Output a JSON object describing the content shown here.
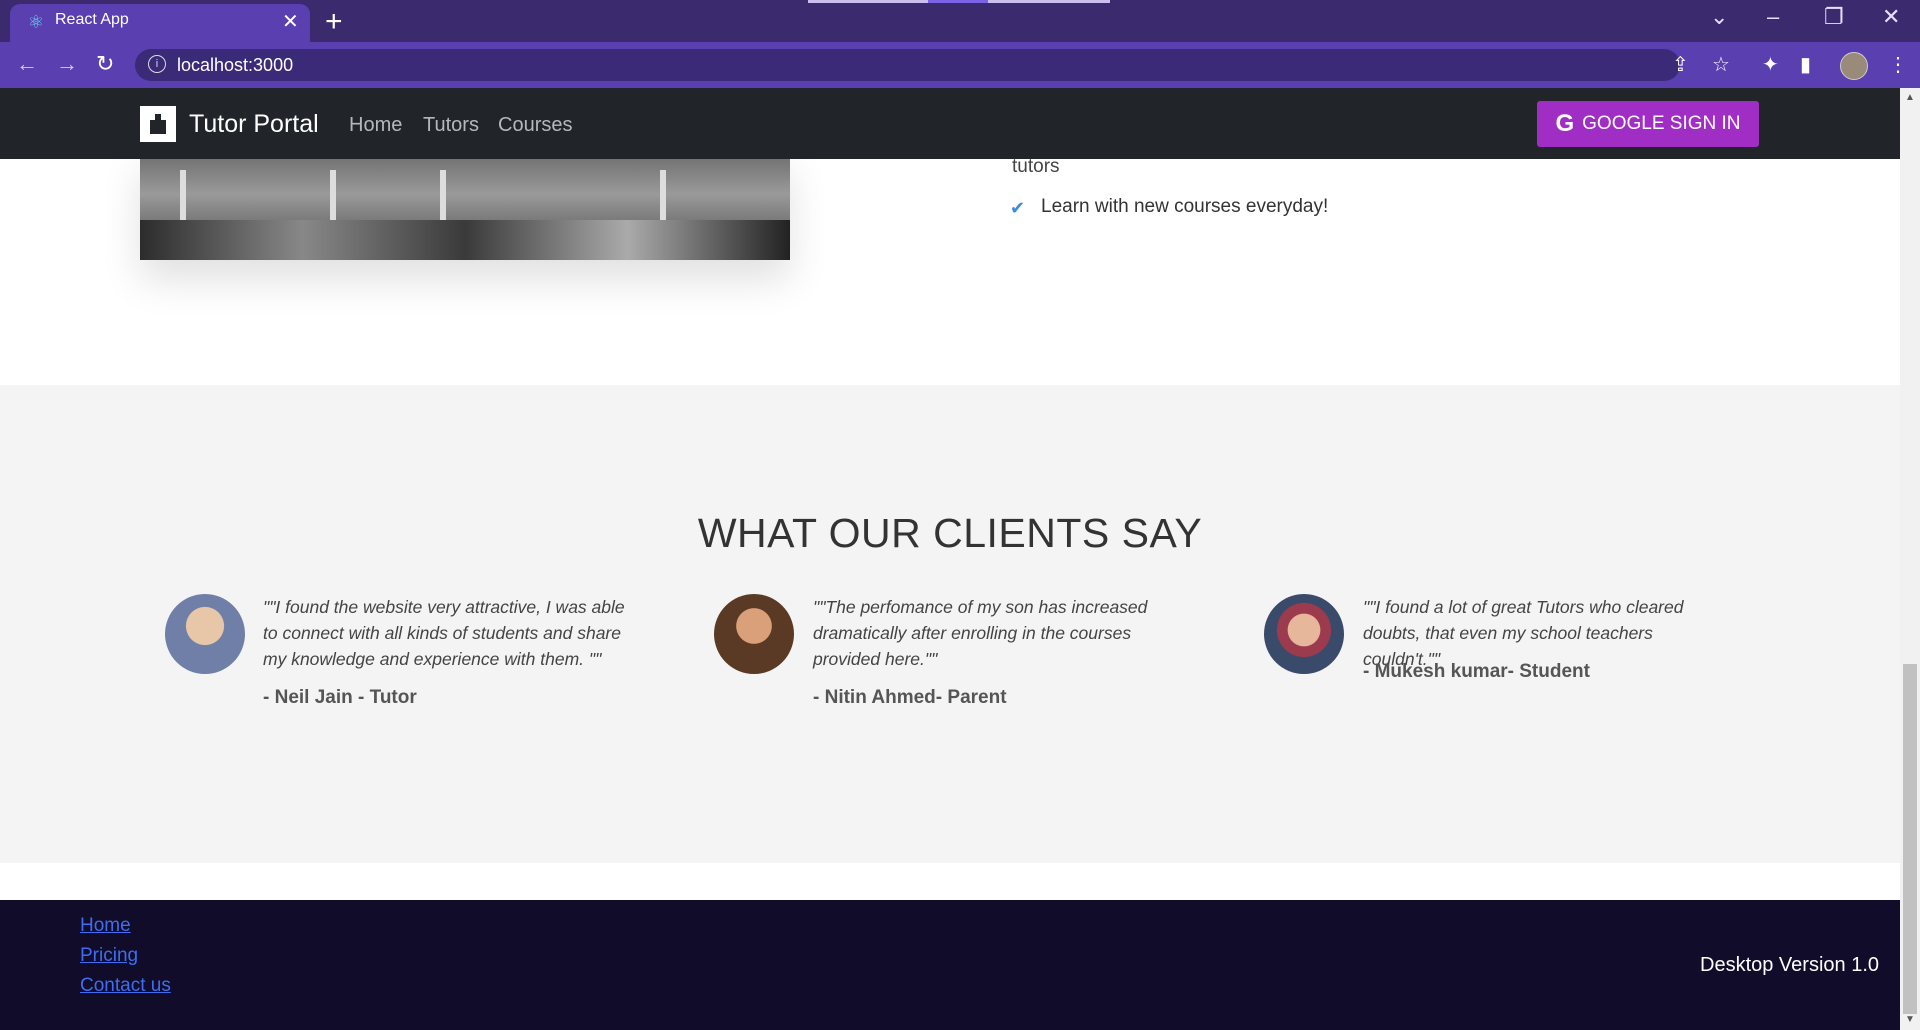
{
  "browser": {
    "tab_title": "React App",
    "url": "localhost:3000",
    "new_tab_glyph": "+",
    "close_glyph": "✕"
  },
  "navbar": {
    "brand": "Tutor Portal",
    "links": [
      "Home",
      "Tutors",
      "Courses"
    ],
    "signin_label": "GOOGLE SIGN IN",
    "signin_icon": "G",
    "signin_color": "#a12ec4"
  },
  "hero": {
    "partial_text": "tutors",
    "items": [
      "Learn with new courses everyday!"
    ]
  },
  "testimonials": {
    "title": "WHAT OUR CLIENTS SAY",
    "items": [
      {
        "quote": "\"\"I found the website very attractive, I was able to connect with all kinds of students and share my knowledge and experience with them. \"\"",
        "author": "- Neil Jain - Tutor"
      },
      {
        "quote": "\"\"The perfomance of my son has increased dramatically after enrolling in the courses provided here.\"\"",
        "author": "- Nitin Ahmed- Parent"
      },
      {
        "quote": "\"\"I found a lot of great Tutors who cleared doubts, that even my school teachers couldn't.\"\"",
        "author": "- Mukesh kumar- Student"
      }
    ]
  },
  "footer": {
    "links": [
      "Home",
      "Pricing",
      "Contact us"
    ],
    "version": "Desktop Version 1.0"
  }
}
